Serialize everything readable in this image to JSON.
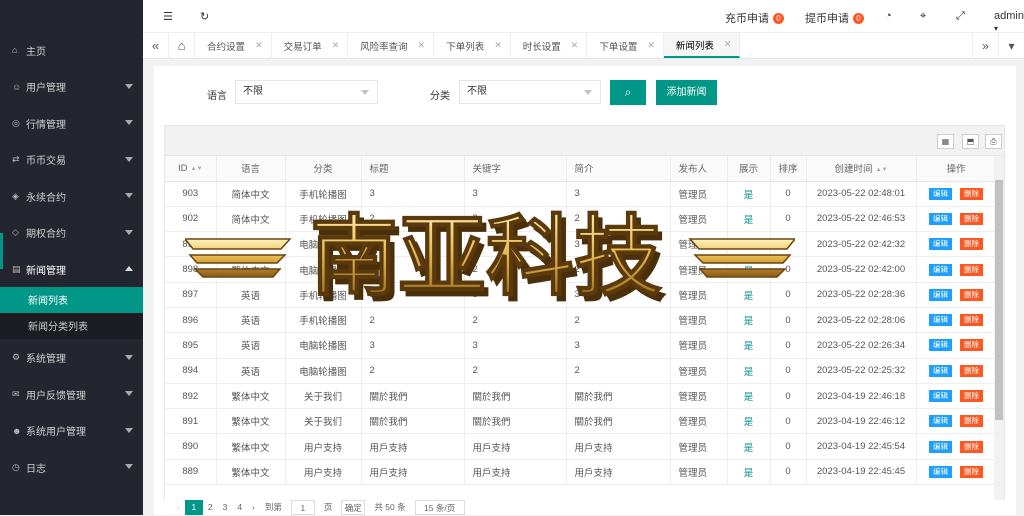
{
  "sidebar": {
    "items": [
      {
        "label": "主页",
        "icon": "home-icon"
      },
      {
        "label": "用户管理",
        "icon": "user-icon"
      },
      {
        "label": "行情管理",
        "icon": "coin-icon"
      },
      {
        "label": "币币交易",
        "icon": "exchange-icon"
      },
      {
        "label": "永续合约",
        "icon": "contract-icon"
      },
      {
        "label": "期权合约",
        "icon": "option-icon"
      },
      {
        "label": "新闻管理",
        "icon": "news-icon"
      },
      {
        "label": "系统管理",
        "icon": "gear-icon"
      },
      {
        "label": "用户反馈管理",
        "icon": "feedback-icon"
      },
      {
        "label": "系统用户管理",
        "icon": "admin-user-icon"
      },
      {
        "label": "日志",
        "icon": "log-icon"
      }
    ],
    "sub": [
      "新闻列表",
      "新闻分类列表"
    ]
  },
  "header": {
    "recharge": "充币申请",
    "recharge_count": "0",
    "withdraw": "提币申请",
    "withdraw_count": "0",
    "user": "admin"
  },
  "tabs": [
    "合约设置",
    "交易订单",
    "风险率查询",
    "下单列表",
    "时长设置",
    "下单设置",
    "新闻列表"
  ],
  "filters": {
    "lang_label": "语言",
    "lang_value": "不限",
    "cat_label": "分类",
    "cat_value": "不限",
    "add_label": "添加新闻"
  },
  "table": {
    "columns": [
      "ID",
      "语言",
      "分类",
      "标题",
      "关键字",
      "简介",
      "发布人",
      "展示",
      "排序",
      "创建时间",
      "操作"
    ],
    "edit_label": "编辑",
    "delete_label": "删除",
    "rows": [
      [
        "903",
        "简体中文",
        "手机轮播图",
        "3",
        "3",
        "3",
        "管理员",
        "是",
        "0",
        "2023-05-22 02:48:01"
      ],
      [
        "902",
        "简体中文",
        "手机轮播图",
        "2",
        "2",
        "2",
        "管理员",
        "是",
        "0",
        "2023-05-22 02:46:53"
      ],
      [
        "899",
        "繁体中文",
        "电脑轮播图",
        "3",
        "3",
        "3",
        "管理员",
        "是",
        "0",
        "2023-05-22 02:42:32"
      ],
      [
        "898",
        "繁体中文",
        "电脑轮播图",
        "2",
        "2",
        "2",
        "管理员",
        "是",
        "0",
        "2023-05-22 02:42:00"
      ],
      [
        "897",
        "英语",
        "手机轮播图",
        "3",
        "3",
        "3",
        "管理员",
        "是",
        "0",
        "2023-05-22 02:28:36"
      ],
      [
        "896",
        "英语",
        "手机轮播图",
        "2",
        "2",
        "2",
        "管理员",
        "是",
        "0",
        "2023-05-22 02:28:06"
      ],
      [
        "895",
        "英语",
        "电脑轮播图",
        "3",
        "3",
        "3",
        "管理员",
        "是",
        "0",
        "2023-05-22 02:26:34"
      ],
      [
        "894",
        "英语",
        "电脑轮播图",
        "2",
        "2",
        "2",
        "管理员",
        "是",
        "0",
        "2023-05-22 02:25:32"
      ],
      [
        "892",
        "繁体中文",
        "关于我们",
        "關於我們",
        "關於我們",
        "關於我們",
        "管理员",
        "是",
        "0",
        "2023-04-19 22:46:18"
      ],
      [
        "891",
        "繁体中文",
        "关于我们",
        "關於我們",
        "關於我們",
        "關於我們",
        "管理员",
        "是",
        "0",
        "2023-04-19 22:46:12"
      ],
      [
        "890",
        "繁体中文",
        "用户支持",
        "用戶支持",
        "用戶支持",
        "用戶支持",
        "管理员",
        "是",
        "0",
        "2023-04-19 22:45:54"
      ],
      [
        "889",
        "繁体中文",
        "用户支持",
        "用戶支持",
        "用戶支持",
        "用戶支持",
        "管理员",
        "是",
        "0",
        "2023-04-19 22:45:45"
      ]
    ]
  },
  "pager": {
    "pages": [
      "1",
      "2",
      "3",
      "4"
    ],
    "goto": "到第",
    "goto_value": "1",
    "page_unit": "页",
    "confirm": "确定",
    "total": "共 50 条",
    "per_page": "15 条/页"
  },
  "watermark": "南亚科技"
}
